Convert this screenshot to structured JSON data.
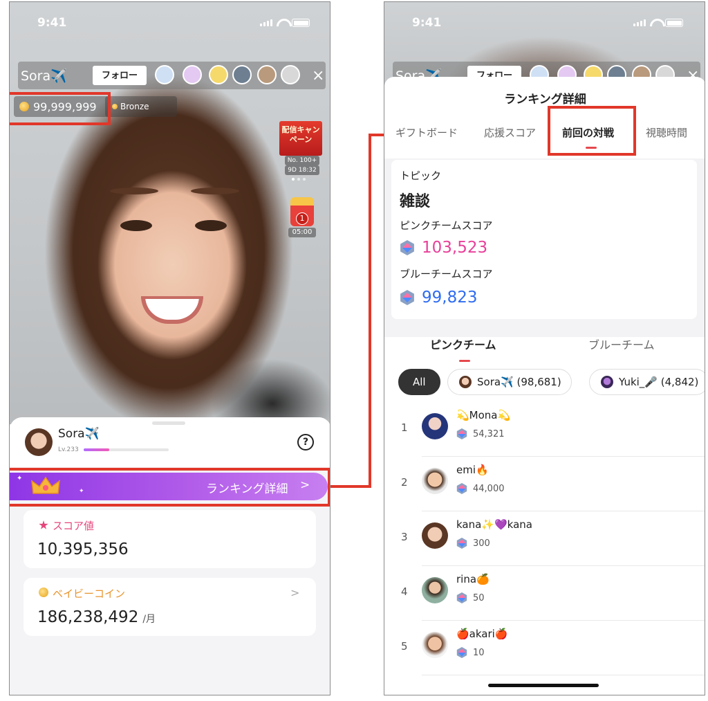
{
  "status_bar": {
    "time": "9:41"
  },
  "left": {
    "host": {
      "name": "Sora✈️",
      "follow_label": "フォロー",
      "close": "×"
    },
    "coins": "99,999,999",
    "badge": "Bronze",
    "campaign": {
      "title": "配信キャンペーン",
      "rank": "No. 100+",
      "time": "9D 18:32"
    },
    "gift": {
      "badge": "1",
      "timer": "05:00"
    },
    "sheet": {
      "name": "Sora✈️",
      "level": "Lv.233",
      "level_progress": 0.3,
      "help": "?",
      "ranking_label": "ランキング詳細",
      "ranking_chevron": ">",
      "score_label": "スコア値",
      "score_value": "10,395,356",
      "coin_label": "ベイビーコイン",
      "coin_value": "186,238,492",
      "coin_unit": "/月",
      "coin_chevron": ">"
    }
  },
  "right": {
    "host": {
      "name": "Sora✈️",
      "follow_label": "フォロー",
      "close": "×"
    },
    "title": "ランキング詳細",
    "tabs": [
      {
        "label": "ギフトボード"
      },
      {
        "label": "応援スコア"
      },
      {
        "label": "前回の対戦",
        "active": true
      },
      {
        "label": "視聴時間"
      }
    ],
    "topic": {
      "label": "トピック",
      "value": "雑談",
      "pink_label": "ピンクチームスコア",
      "pink_score": "103,523",
      "blue_label": "ブルーチームスコア",
      "blue_score": "99,823"
    },
    "team_tabs": [
      {
        "label": "ピンクチーム",
        "active": true
      },
      {
        "label": "ブルーチーム"
      }
    ],
    "chips": [
      {
        "label": "All"
      },
      {
        "label": "Sora✈️ (98,681)"
      },
      {
        "label": "Yuki_🎤 (4,842)"
      }
    ],
    "rows": [
      {
        "rank": "1",
        "name": "💫Mona💫",
        "score": "54,321"
      },
      {
        "rank": "2",
        "name": "emi🔥",
        "score": "44,000"
      },
      {
        "rank": "3",
        "name": "kana✨💜kana",
        "score": "300"
      },
      {
        "rank": "4",
        "name": "rina🍊",
        "score": "50"
      },
      {
        "rank": "5",
        "name": "🍎akari🍎",
        "score": "10"
      }
    ]
  },
  "colors": {
    "pink": "#e8409a",
    "blue": "#2f6cf0",
    "annotation": "#e1372a",
    "purple": "#9d43e8"
  }
}
